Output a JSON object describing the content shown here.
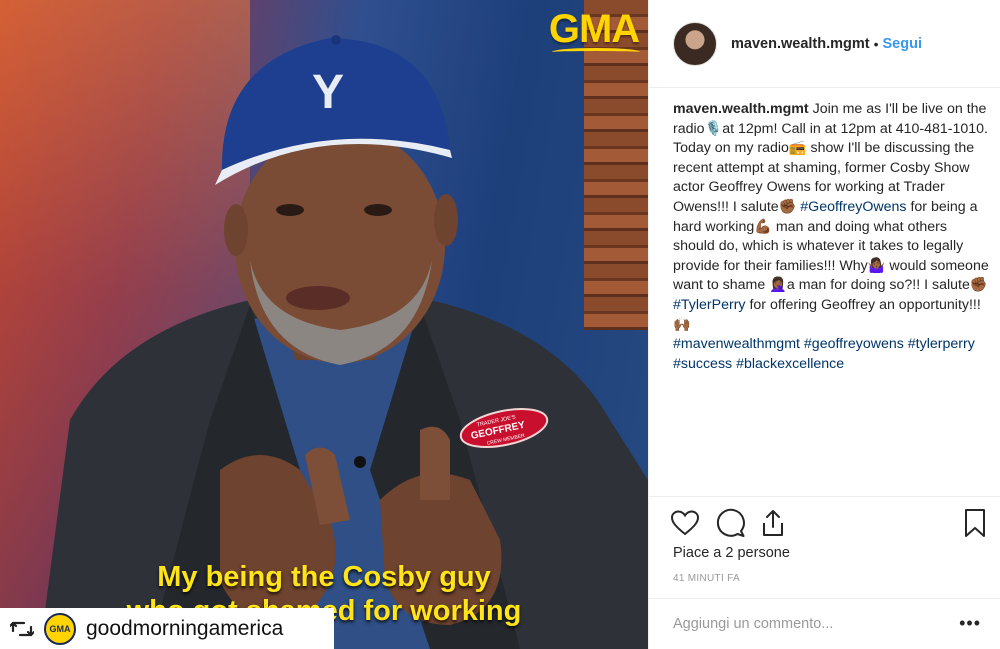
{
  "media": {
    "logo_text": "GMA",
    "caption_line1": "My being the Cosby guy",
    "caption_line2": "who got shamed for working",
    "cap_letter": "Y",
    "badge_line1": "TRADER JOE'S",
    "badge_line2": "GEOFFREY",
    "badge_line3": "CREW MEMBER"
  },
  "repost": {
    "icon": "repost-icon",
    "avatar_text": "GMA",
    "account": "goodmorningamerica"
  },
  "post": {
    "username": "maven.wealth.mgmt",
    "separator": "•",
    "follow_label": "Segui",
    "caption_user": "maven.wealth.mgmt",
    "caption_part1": "Join me as I'll be live on the radio🎙️at 12pm! Call in at 12pm at 410-481-1010. Today on my radio📻 show I'll be discussing the recent attempt at shaming, former Cosby Show actor Geoffrey Owens for working at Trader Owens!!! I salute✊🏾",
    "caption_tag1": "#GeoffreyOwens",
    "caption_part2": " for being a hard working💪🏾 man and doing what others should do, which is whatever it takes to legally provide for their families!!! Why🤷🏾‍♀️ would someone want to shame 🤦🏾‍♀️a man for doing so?!! I salute✊🏾 ",
    "caption_tag2": "#TylerPerry",
    "caption_part3": " for offering Geoffrey an opportunity!!!🙌🏾",
    "hashtags": [
      "#mavenwealthmgmt",
      "#geoffreyowens",
      "#tylerperry",
      "#success",
      "#blackexcellence"
    ],
    "likes_text": "Piace a 2 persone",
    "time_text": "41 MINUTI FA",
    "comment_placeholder": "Aggiungi un commento...",
    "more_label": "•••",
    "actions": [
      "heart-icon",
      "comment-icon",
      "share-icon",
      "bookmark-icon"
    ]
  },
  "colors": {
    "link": "#3897f0",
    "hashtag": "#003569",
    "gma_yellow": "#ffd400",
    "caption_yellow": "#ffe419"
  }
}
